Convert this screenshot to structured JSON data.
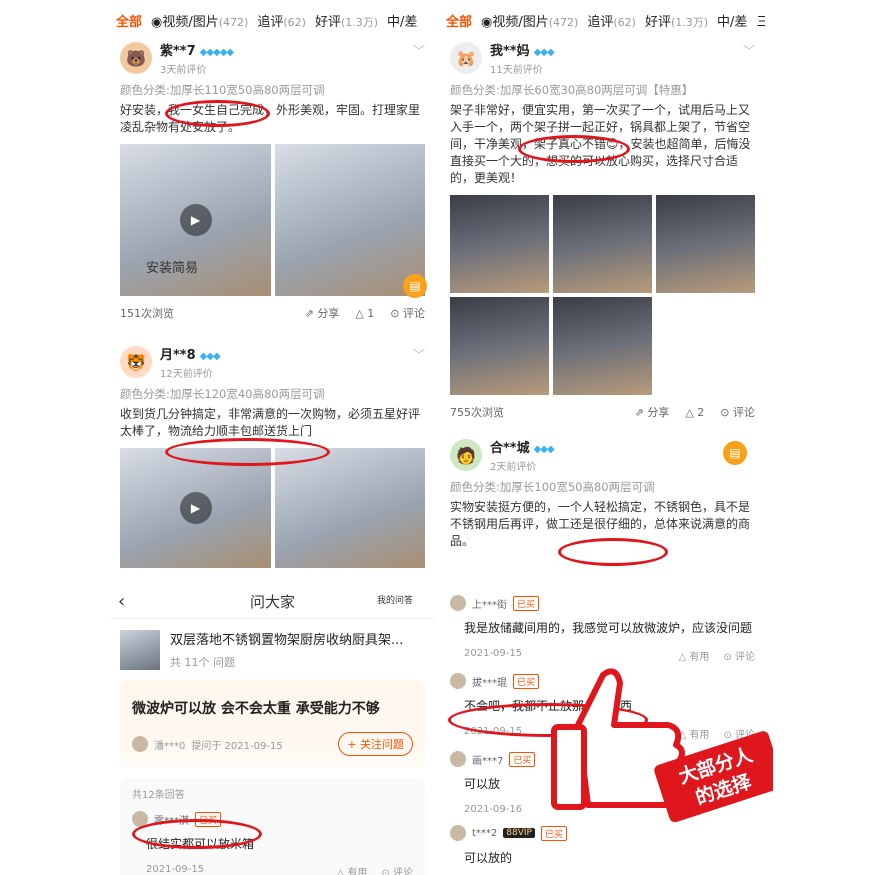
{
  "tabs": [
    {
      "label": "全部",
      "count": ""
    },
    {
      "label": "◉视频/图片",
      "count": "(472)"
    },
    {
      "label": "追评",
      "count": "(62)"
    },
    {
      "label": "好评",
      "count": "(1.3万)"
    },
    {
      "label": "中/差",
      "count": ""
    },
    {
      "label": "三l",
      "count": ""
    }
  ],
  "reviews_left": [
    {
      "user": "紫**7",
      "date": "3天前评价",
      "variant": "颜色分类:加厚长110宽50高80两层可调",
      "text": "好安装，我一女生自己完成，外形美观，牢固。打理家里凌乱杂物有处安放了。",
      "photo_caption": "安装简易",
      "views": "151次浏览",
      "share": "分享",
      "likes": "1",
      "comment": "评论"
    },
    {
      "user": "月**8",
      "date": "12天前评价",
      "variant": "颜色分类:加厚长120宽40高80两层可调",
      "text": "收到货几分钟搞定，非常满意的一次购物，必须五星好评太棒了，物流给力顺丰包邮送货上门"
    }
  ],
  "reviews_right": [
    {
      "user": "我**妈",
      "date": "11天前评价",
      "variant": "颜色分类:加厚长60宽30高80两层可调【特惠】",
      "text": "架子非常好，便宜实用，第一次买了一个，试用后马上又入手一个，两个架子拼一起正好，锅具都上架了，节省空间，干净美观，架子真心不错😊，安装也超简单，后悔没直接买一个大的，想买的可以放心购买，选择尺寸合适的，更美观！",
      "views": "755次浏览",
      "share": "分享",
      "likes": "2",
      "comment": "评论"
    },
    {
      "user": "合**城",
      "date": "2天前评价",
      "variant": "颜色分类:加厚长100宽50高80两层可调",
      "text": "实物安装挺方便的，一个人轻松搞定，不锈钢色，具不是不锈钢用后再评，做工还是很仔细的，总体来说满意的商品。"
    }
  ],
  "qa": {
    "title": "问大家",
    "my_questions": "我的问答",
    "product_title": "双层落地不锈钢置物架厨房收纳厨具架...",
    "product_questions": "共 11个 问题",
    "question": "微波炉可以放 会不会太重 承受能力不够",
    "asker": "潘***0",
    "asked_date": "提问于 2021-09-15",
    "follow": "+ 关注问题",
    "answer_count": "共12条回答",
    "first_answer": {
      "user": "零***淇",
      "badge": "已买",
      "text": "很结实都可以放米箱",
      "date": "2021-09-15",
      "useful": "有用",
      "comment": "评论"
    }
  },
  "answers": [
    {
      "user": "上***街",
      "badge": "已买",
      "text": "我是放储藏间用的，我感觉可以放微波炉，应该没问题",
      "date": "2021-09-15",
      "useful": "有用",
      "comment": "评论"
    },
    {
      "user": "拔***琨",
      "badge": "已买",
      "text": "不会吧，我都不止放那么多东西",
      "date": "2021-09-15",
      "useful": "有用",
      "comment": "评论"
    },
    {
      "user": "画***7",
      "badge": "已买",
      "text": "可以放",
      "date": "2021-09-16"
    },
    {
      "user": "t***2",
      "vip": "88VIP",
      "badge": "已买",
      "text": "可以放的"
    }
  ],
  "overlay": {
    "line1": "大部分人",
    "line2": "的选择"
  },
  "colors": {
    "accent": "#ff5000",
    "highlight": "#e0161d",
    "diamond": "#3ab0f0"
  }
}
